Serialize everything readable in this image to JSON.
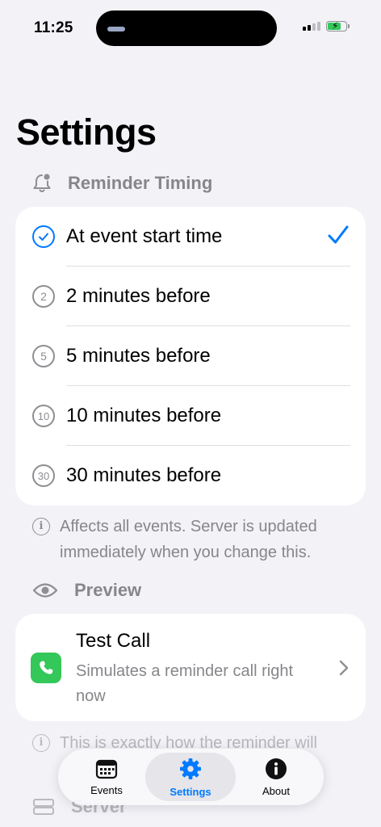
{
  "status_bar": {
    "time": "11:25"
  },
  "page_title": "Settings",
  "reminder_section": {
    "header": "Reminder Timing",
    "options": [
      {
        "icon_text": "",
        "label": "At event start time",
        "selected": true
      },
      {
        "icon_text": "2",
        "label": "2 minutes before",
        "selected": false
      },
      {
        "icon_text": "5",
        "label": "5 minutes before",
        "selected": false
      },
      {
        "icon_text": "10",
        "label": "10 minutes before",
        "selected": false
      },
      {
        "icon_text": "30",
        "label": "30 minutes before",
        "selected": false
      }
    ],
    "footnote": "Affects all events. Server is updated immediately when you change this."
  },
  "preview_section": {
    "header": "Preview",
    "test_call": {
      "title": "Test Call",
      "subtitle": "Simulates a reminder call right now"
    },
    "footnote": "This is exactly how the reminder will"
  },
  "server_section": {
    "header": "Server"
  },
  "tab_bar": {
    "tabs": [
      {
        "label": "Events",
        "icon": "calendar-icon",
        "active": false
      },
      {
        "label": "Settings",
        "icon": "gear-icon",
        "active": true
      },
      {
        "label": "About",
        "icon": "info-icon",
        "active": false
      }
    ]
  },
  "colors": {
    "accent": "#007aff",
    "background": "#f2f2f7",
    "call_green": "#34c759",
    "secondary_text": "#86868b"
  }
}
